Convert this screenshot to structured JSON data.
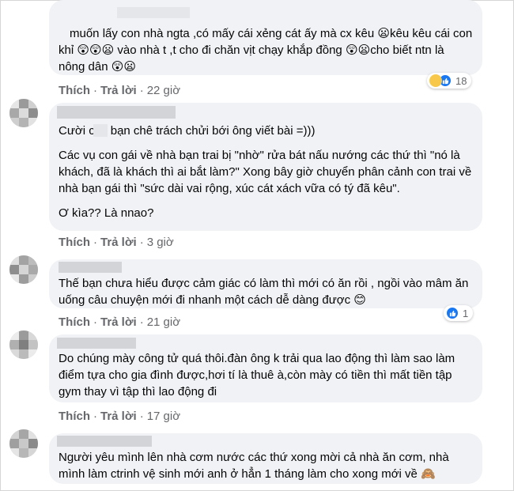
{
  "action_labels": {
    "like": "Thích",
    "reply": "Trả lời",
    "separator": "·"
  },
  "comments": [
    {
      "paragraphs": [
        "muốn lấy con nhà ngta ,có mấy cái xẻng cát ấy mà cx kêu 😦kêu kêu cái con khỉ 😲😲😦 vào nhà t ,t cho đi chăn vịt chạy khắp đồng 😲😦cho biết ntn là nông dân 😲😦"
      ],
      "time": "22 giờ",
      "reaction_count": "18",
      "reaction_icons": [
        "haha-icon",
        "like-icon"
      ]
    },
    {
      "paragraphs": [
        "Cười   các bạn chê trách chửi bới ông viết bài =)))",
        "Các vụ con gái về nhà bạn trai bị \"nhờ\" rửa bát nấu nướng các thứ thì \"nó là khách, đã là khách thì ai bắt làm?\" Xong bây giờ chuyển phân cảnh con trai về nhà bạn gái thì \"sức dài vai rộng, xúc cát xách vữa có tý đã kêu\".",
        "Ơ kìa?? Là nnao?"
      ],
      "time": "3 giờ"
    },
    {
      "paragraphs": [
        "Thế bạn chưa hiểu được cảm giác có làm thì mới có ăn rồi , ngồi vào mâm ăn uống câu chuyện mới đi nhanh một cách dễ dàng được 😊"
      ],
      "time": "21 giờ",
      "reaction_count": "1",
      "reaction_icons": [
        "like-icon"
      ]
    },
    {
      "paragraphs": [
        "Do chúng mày công tử quá thôi.đàn ông k trải qua lao động thì làm sao làm điểm tựa cho gia đình được,hơi tí là thuê à,còn mày có tiền thì mất tiền tập gym thay vì tập thì lao động đi"
      ],
      "time": "17 giờ"
    },
    {
      "paragraphs": [
        "Người yêu mình lên nhà cơm nước các thứ xong mời cả nhà ăn cơm, nhà mình làm ctrinh vệ sinh mới anh ở hẳn 1 tháng làm cho xong mới về 🙈"
      ]
    }
  ]
}
